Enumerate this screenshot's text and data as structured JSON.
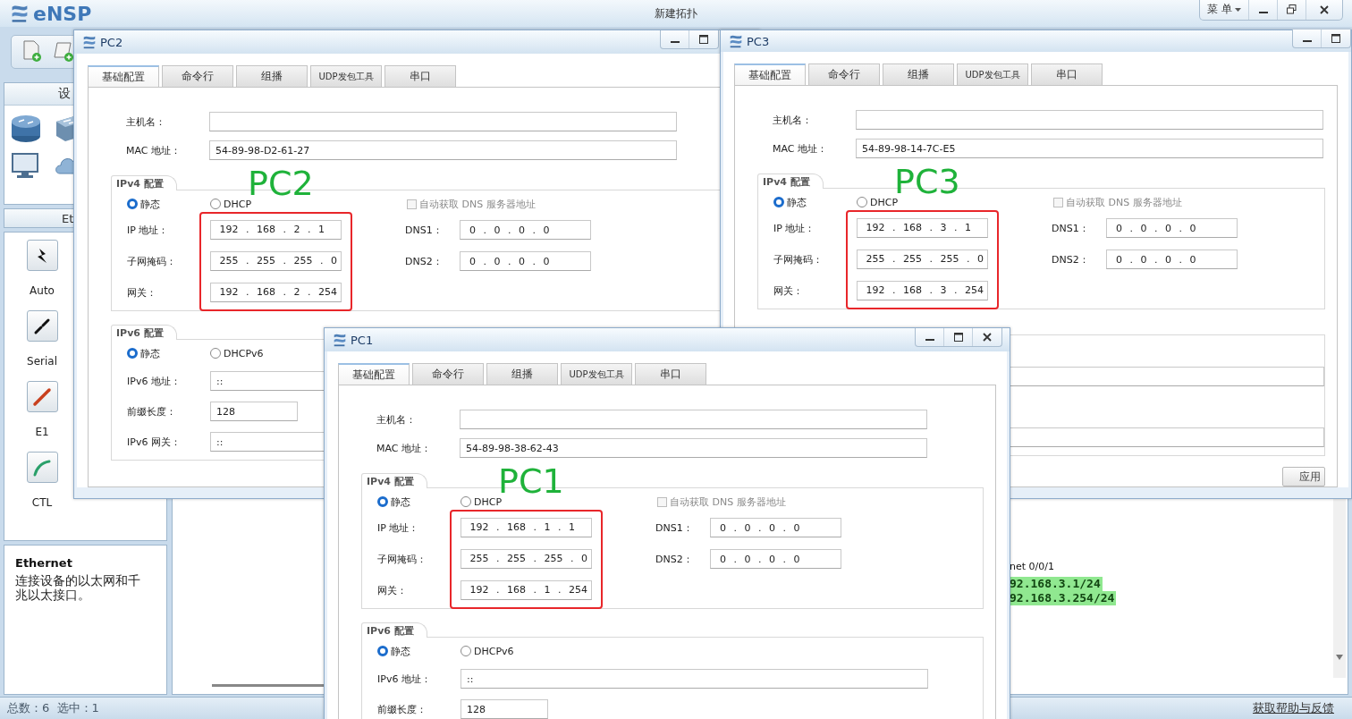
{
  "main_window": {
    "logo": "eNSP",
    "title": "新建拓扑",
    "menu_button": "菜 单"
  },
  "left_panel": {
    "devices_header": "设",
    "section_header": "Et",
    "cables": [
      {
        "label": "Auto",
        "kind": "auto"
      },
      {
        "label": "Serial",
        "kind": "serial"
      },
      {
        "label": "E1",
        "kind": "e1"
      },
      {
        "label": "CTL",
        "kind": "ctl"
      }
    ],
    "info": {
      "title": "Ethernet",
      "text": "连接设备的以太网和千兆以太接口。"
    }
  },
  "canvas": {
    "labels": [
      {
        "text": "net 0/0/1",
        "kind": "port"
      },
      {
        "text": "92.168.3.1/24",
        "kind": "address"
      },
      {
        "text": "92.168.3.254/24",
        "kind": "address"
      }
    ]
  },
  "status_bar": {
    "summary": "总数：6  选中：1",
    "link": "获取帮助与反馈"
  },
  "windows": [
    {
      "title": "PC2",
      "controls": [
        {
          "kind": "minimize"
        },
        {
          "kind": "maximize"
        }
      ],
      "annotation": "PC2",
      "tabs": [
        {
          "label": "基础配置",
          "selected": true
        },
        {
          "label": "命令行",
          "selected": false
        },
        {
          "label": "组播",
          "selected": false
        },
        {
          "label": "UDP发包工具",
          "selected": false
        },
        {
          "label": "串口",
          "selected": false
        }
      ],
      "hostname": {
        "label": "主机名："
      },
      "mac": {
        "label": "MAC 地址：",
        "value": "54-89-98-D2-61-27"
      },
      "ipv4": {
        "title": "IPv4 配置",
        "highlighted": true,
        "modes": [
          {
            "label": "静态",
            "selected": true
          },
          {
            "label": "DHCP",
            "selected": false
          }
        ],
        "auto_dns": {
          "label": "自动获取 DNS 服务器地址",
          "checked": false,
          "disabled": true
        },
        "rows": [
          {
            "label": "IP 地址：",
            "value": "192 . 168 . 2 . 1"
          },
          {
            "label": "子网掩码：",
            "value": "255 . 255 . 255 . 0"
          },
          {
            "label": "网关：",
            "value": "192 . 168 . 2 . 254"
          }
        ],
        "dns": [
          {
            "label": "DNS1：",
            "value": "0 . 0 . 0 . 0"
          },
          {
            "label": "DNS2：",
            "value": "0 . 0 . 0 . 0"
          }
        ]
      },
      "ipv6": {
        "title": "IPv6 配置",
        "modes": [
          {
            "label": "静态",
            "selected": true
          },
          {
            "label": "DHCPv6",
            "selected": false
          }
        ],
        "address": {
          "label": "IPv6 地址：",
          "value": "::",
          "kind": "wide"
        },
        "prefix": {
          "label": "前缀长度：",
          "value": "128",
          "kind": "short"
        },
        "gateway": {
          "label": "IPv6 网关：",
          "value": "::",
          "kind": "wide"
        }
      }
    },
    {
      "title": "PC3",
      "controls": [
        {
          "kind": "minimize"
        },
        {
          "kind": "maximize"
        }
      ],
      "annotation": "PC3",
      "tabs": [
        {
          "label": "基础配置",
          "selected": true
        },
        {
          "label": "命令行",
          "selected": false
        },
        {
          "label": "组播",
          "selected": false
        },
        {
          "label": "UDP发包工具",
          "selected": false
        },
        {
          "label": "串口",
          "selected": false
        }
      ],
      "hostname": {
        "label": "主机名："
      },
      "mac": {
        "label": "MAC 地址：",
        "value": "54-89-98-14-7C-E5"
      },
      "ipv4": {
        "title": "IPv4 配置",
        "highlighted": true,
        "modes": [
          {
            "label": "静态",
            "selected": true
          },
          {
            "label": "DHCP",
            "selected": false
          }
        ],
        "auto_dns": {
          "label": "自动获取 DNS 服务器地址",
          "checked": false,
          "disabled": true
        },
        "rows": [
          {
            "label": "IP 地址：",
            "value": "192 . 168 . 3 . 1"
          },
          {
            "label": "子网掩码：",
            "value": "255 . 255 . 255 . 0"
          },
          {
            "label": "网关：",
            "value": "192 . 168 . 3 . 254"
          }
        ],
        "dns": [
          {
            "label": "DNS1：",
            "value": "0 . 0 . 0 . 0"
          },
          {
            "label": "DNS2：",
            "value": "0 . 0 . 0 . 0"
          }
        ]
      },
      "ipv6": {
        "address": {
          "kind": "wide"
        },
        "gateway": {
          "kind": "wide"
        }
      },
      "apply": "应用"
    },
    {
      "title": "PC1",
      "controls": [
        {
          "kind": "minimize"
        },
        {
          "kind": "maximize"
        },
        {
          "kind": "close"
        }
      ],
      "annotation": "PC1",
      "tabs": [
        {
          "label": "基础配置",
          "selected": true
        },
        {
          "label": "命令行",
          "selected": false
        },
        {
          "label": "组播",
          "selected": false
        },
        {
          "label": "UDP发包工具",
          "selected": false
        },
        {
          "label": "串口",
          "selected": false
        }
      ],
      "hostname": {
        "label": "主机名："
      },
      "mac": {
        "label": "MAC 地址：",
        "value": "54-89-98-38-62-43"
      },
      "ipv4": {
        "title": "IPv4 配置",
        "highlighted": true,
        "modes": [
          {
            "label": "静态",
            "selected": true
          },
          {
            "label": "DHCP",
            "selected": false
          }
        ],
        "auto_dns": {
          "label": "自动获取 DNS 服务器地址",
          "checked": false,
          "disabled": true
        },
        "rows": [
          {
            "label": "IP 地址：",
            "value": "192 . 168 . 1 . 1"
          },
          {
            "label": "子网掩码：",
            "value": "255 . 255 . 255 . 0"
          },
          {
            "label": "网关：",
            "value": "192 . 168 . 1 . 254"
          }
        ],
        "dns": [
          {
            "label": "DNS1：",
            "value": "0 . 0 . 0 . 0"
          },
          {
            "label": "DNS2：",
            "value": "0 . 0 . 0 . 0"
          }
        ]
      },
      "ipv6": {
        "title": "IPv6 配置",
        "modes": [
          {
            "label": "静态",
            "selected": true
          },
          {
            "label": "DHCPv6",
            "selected": false
          }
        ],
        "address": {
          "label": "IPv6 地址：",
          "value": "::",
          "kind": "wide"
        },
        "prefix": {
          "label": "前缀长度：",
          "value": "128",
          "kind": "short"
        }
      }
    }
  ]
}
